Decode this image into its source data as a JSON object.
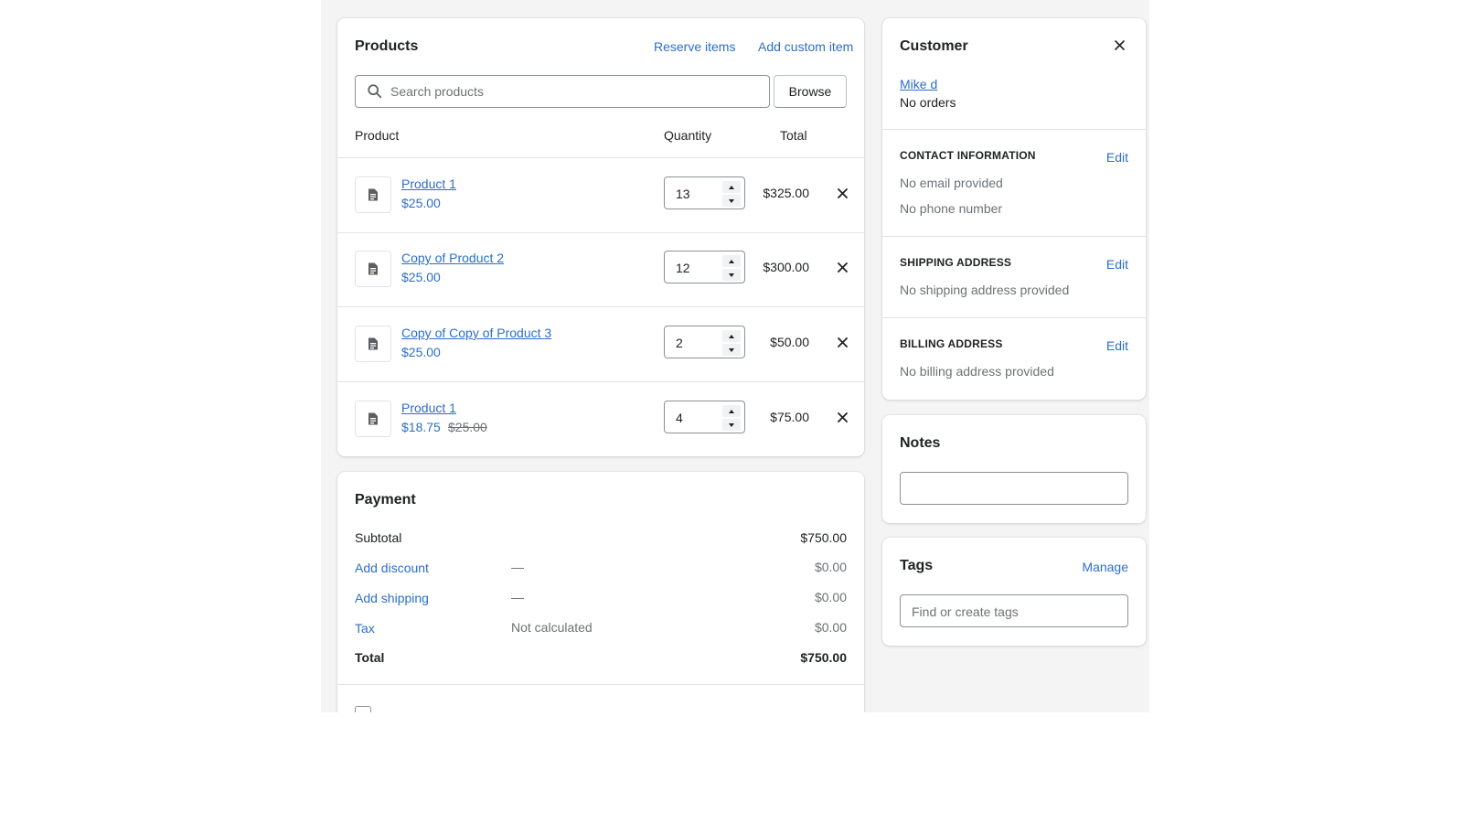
{
  "products": {
    "title": "Products",
    "reserve_items": "Reserve items",
    "add_custom_item": "Add custom item",
    "search_placeholder": "Search products",
    "browse": "Browse",
    "col_product": "Product",
    "col_quantity": "Quantity",
    "col_total": "Total",
    "items": [
      {
        "name": "Product 1",
        "price": "$25.00",
        "original_price": "",
        "qty": "13",
        "total": "$325.00"
      },
      {
        "name": "Copy of Product 2",
        "price": "$25.00",
        "original_price": "",
        "qty": "12",
        "total": "$300.00"
      },
      {
        "name": "Copy of Copy of Product 3",
        "price": "$25.00",
        "original_price": "",
        "qty": "2",
        "total": "$50.00"
      },
      {
        "name": "Product 1",
        "price": "$18.75",
        "original_price": "$25.00",
        "qty": "4",
        "total": "$75.00"
      }
    ]
  },
  "payment": {
    "title": "Payment",
    "subtotal_label": "Subtotal",
    "subtotal_value": "$750.00",
    "discount_label": "Add discount",
    "discount_desc": "—",
    "discount_value": "$0.00",
    "shipping_label": "Add shipping",
    "shipping_desc": "—",
    "shipping_value": "$0.00",
    "tax_label": "Tax",
    "tax_desc": "Not calculated",
    "tax_value": "$0.00",
    "total_label": "Total",
    "total_value": "$750.00"
  },
  "customer": {
    "title": "Customer",
    "name": "Mike d",
    "orders": "No orders",
    "contact_header": "CONTACT INFORMATION",
    "contact_edit": "Edit",
    "email": "No email provided",
    "phone": "No phone number",
    "shipping_header": "SHIPPING ADDRESS",
    "shipping_edit": "Edit",
    "shipping_text": "No shipping address provided",
    "billing_header": "BILLING ADDRESS",
    "billing_edit": "Edit",
    "billing_text": "No billing address provided"
  },
  "notes": {
    "title": "Notes",
    "value": ""
  },
  "tags": {
    "title": "Tags",
    "manage": "Manage",
    "placeholder": "Find or create tags"
  },
  "colors": {
    "link": "#2c6ecb",
    "background": "#f4f4f5",
    "card": "#ffffff",
    "text": "#202223",
    "muted": "#6d7175"
  }
}
